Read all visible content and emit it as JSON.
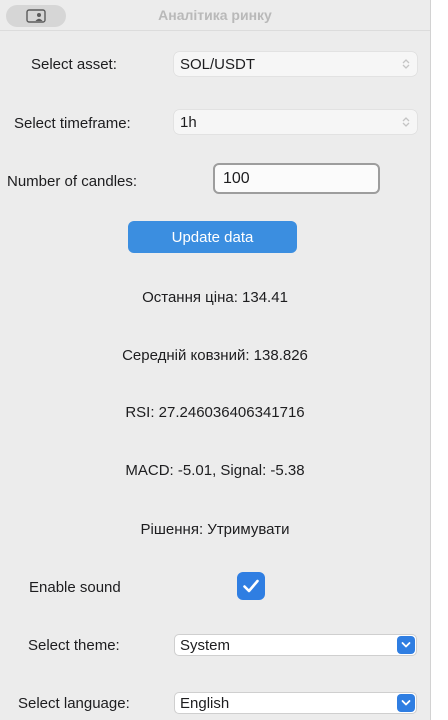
{
  "window": {
    "title": "Аналітика ринку"
  },
  "asset": {
    "label": "Select asset:",
    "value": "SOL/USDT"
  },
  "timeframe": {
    "label": "Select timeframe:",
    "value": "1h"
  },
  "candles": {
    "label": "Number of candles:",
    "value": "100"
  },
  "update_button": {
    "label": "Update data"
  },
  "stats": {
    "last_price": "Остання ціна: 134.41",
    "moving_average": "Середній ковзний: 138.826",
    "rsi": "RSI: 27.246036406341716",
    "macd": "MACD: -5.01, Signal: -5.38",
    "decision": "Рішення: Утримувати"
  },
  "sound": {
    "label": "Enable sound",
    "checked": true
  },
  "theme": {
    "label": "Select theme:",
    "value": "System"
  },
  "language": {
    "label": "Select language:",
    "value": "English"
  },
  "colors": {
    "accent": "#2f7ee2",
    "button": "#3b8ee0",
    "window_bg": "#ececec"
  },
  "icons": [
    "sidebar-icon",
    "chevron-up-down-icon",
    "checkmark-icon",
    "chevron-down-icon"
  ]
}
